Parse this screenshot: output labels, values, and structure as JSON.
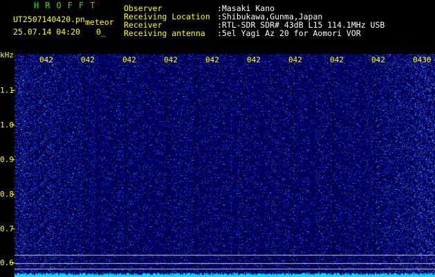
{
  "header": {
    "brand": "HROFFT",
    "filename": "UT2507140420.pn",
    "mode": "meteor",
    "datetime": "25.07.14 04:20",
    "count": "0_",
    "info_labels": [
      "Observer",
      "Receiving Location",
      "Receiver",
      "Receiving antenna"
    ],
    "info_values": [
      ":Masaki Kano",
      ":Shibukawa,Gunma,Japan",
      ":RTL-SDR SDR# 43dB L15 114.1MHz USB",
      ":5el Yagi Az 20 for Aomori VOR"
    ]
  },
  "x_axis": {
    "tick_labels": [
      "042",
      "042",
      "042",
      "042",
      "042",
      "042",
      "042",
      "042",
      "042",
      "0430"
    ]
  },
  "y_axis": {
    "unit": "kHz",
    "tick_labels": [
      "1.1",
      "1.0",
      "0.9",
      "0.8",
      "0.7",
      "0.6"
    ]
  },
  "colors": {
    "background": "#000000",
    "spectrogram_base": "#00006a",
    "noise_floor": "#00d8ff",
    "axis_text": "#ffff00",
    "brand_text": "#22e022"
  }
}
